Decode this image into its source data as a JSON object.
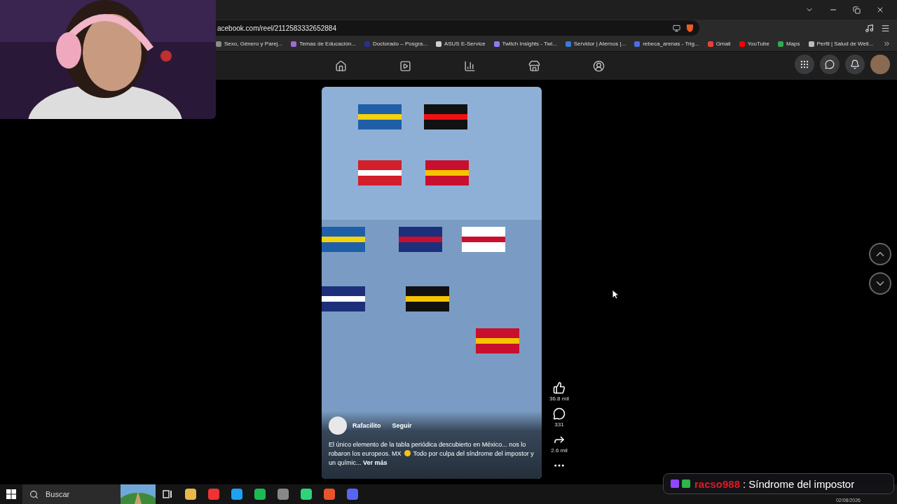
{
  "address_bar": {
    "url": "acebook.com/reel/2112583332652884"
  },
  "bookmarks": [
    {
      "label": "Sexo, Género y Parej...",
      "color": "#8a8a8a"
    },
    {
      "label": "Temas de Educación...",
      "color": "#9b6bd6"
    },
    {
      "label": "Doctorado – Posgra...",
      "color": "#2a2f8f"
    },
    {
      "label": "ASUS E-Service",
      "color": "#d0d0d0"
    },
    {
      "label": "Twitch Insights - Twi...",
      "color": "#8e7cf0"
    },
    {
      "label": "Servidor | Aternos |...",
      "color": "#3b7ad6"
    },
    {
      "label": "rebeca_arenas - Trig...",
      "color": "#4a6fe0"
    },
    {
      "label": "Gmail",
      "color": "#e94235"
    },
    {
      "label": "YouTube",
      "color": "#ff0000"
    },
    {
      "label": "Maps",
      "color": "#34a853"
    },
    {
      "label": "Perfil | Salud de Well...",
      "color": "#bdbdbd"
    }
  ],
  "reel": {
    "author": "Rafacilito",
    "follow": "Seguir",
    "caption_start": "El único elemento de la tabla periódica descubierto en México... nos lo robaron los europeos. MX",
    "caption_end": "Todo por culpa del síndrome del impostor y un químic...",
    "more_link": "Ver más",
    "actions": [
      {
        "kind": "like",
        "count": "36.8 mil"
      },
      {
        "kind": "comment",
        "count": "331"
      },
      {
        "kind": "share",
        "count": "2.6 mil"
      },
      {
        "kind": "more"
      }
    ]
  },
  "taskbar": {
    "search": {
      "placeholder": "Buscar"
    },
    "date": "02/08/2026"
  },
  "chat": {
    "user": "racso988",
    "separator": ":",
    "message": "Síndrome del impostor"
  }
}
